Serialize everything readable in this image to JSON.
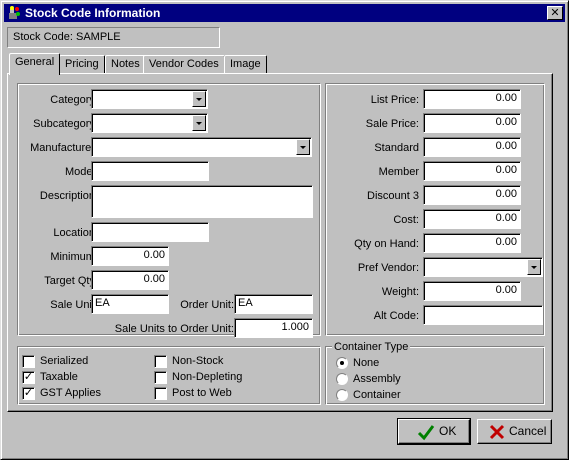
{
  "window": {
    "title": "Stock Code Information",
    "close_glyph": "✕"
  },
  "stock_code_label": "Stock Code: SAMPLE",
  "tabs": [
    {
      "label": "General",
      "active": true
    },
    {
      "label": "Pricing",
      "active": false
    },
    {
      "label": "Notes",
      "active": false
    },
    {
      "label": "Vendor Codes",
      "active": false
    },
    {
      "label": "Image",
      "active": false
    }
  ],
  "left": {
    "category": {
      "label": "Category:",
      "value": ""
    },
    "subcategory": {
      "label": "Subcategory:",
      "value": ""
    },
    "manufacturer": {
      "label": "Manufacturer:",
      "value": ""
    },
    "model": {
      "label": "Model:",
      "value": ""
    },
    "description": {
      "label": "Description:",
      "value": ""
    },
    "location": {
      "label": "Location:",
      "value": ""
    },
    "minimum": {
      "label": "Minimum:",
      "value": "0.00"
    },
    "target_qty": {
      "label": "Target Qty:",
      "value": "0.00"
    },
    "sale_unit": {
      "label": "Sale Unit:",
      "value": "EA"
    },
    "order_unit": {
      "label": "Order Unit:",
      "value": "EA"
    },
    "conversion": {
      "label": "Sale Units to Order Unit:",
      "value": "1.000"
    }
  },
  "right": {
    "list_price": {
      "label": "List Price:",
      "value": "0.00"
    },
    "sale_price": {
      "label": "Sale Price:",
      "value": "0.00"
    },
    "standard": {
      "label": "Standard",
      "value": "0.00"
    },
    "member": {
      "label": "Member",
      "value": "0.00"
    },
    "discount3": {
      "label": "Discount 3",
      "value": "0.00"
    },
    "cost": {
      "label": "Cost:",
      "value": "0.00"
    },
    "qty_on_hand": {
      "label": "Qty on Hand:",
      "value": "0.00"
    },
    "pref_vendor": {
      "label": "Pref Vendor:",
      "value": ""
    },
    "weight": {
      "label": "Weight:",
      "value": "0.00"
    },
    "alt_code": {
      "label": "Alt Code:",
      "value": ""
    }
  },
  "options": [
    {
      "label": "Serialized",
      "checked": false
    },
    {
      "label": "Taxable",
      "checked": true
    },
    {
      "label": "GST Applies",
      "checked": true
    },
    {
      "label": "Non-Stock",
      "checked": false
    },
    {
      "label": "Non-Depleting",
      "checked": false
    },
    {
      "label": "Post to Web",
      "checked": false
    }
  ],
  "container_type": {
    "legend": "Container Type",
    "choices": [
      "None",
      "Assembly",
      "Container"
    ],
    "selected": "None"
  },
  "buttons": {
    "ok": "OK",
    "cancel": "Cancel"
  },
  "check_glyph": "✓"
}
